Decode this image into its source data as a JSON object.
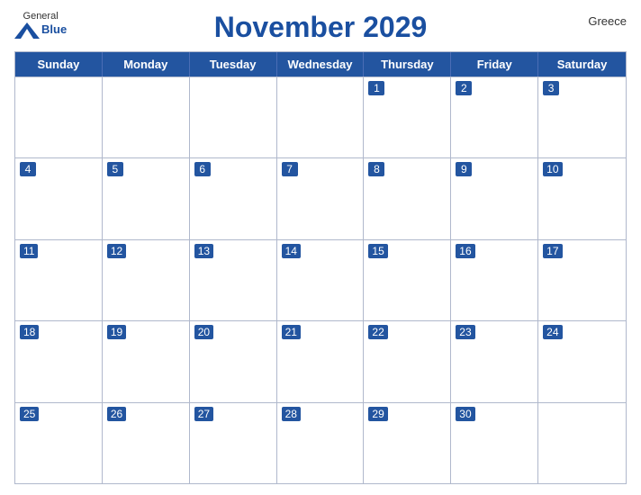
{
  "header": {
    "title": "November 2029",
    "country": "Greece",
    "logo": {
      "general": "General",
      "blue": "Blue"
    }
  },
  "calendar": {
    "day_headers": [
      "Sunday",
      "Monday",
      "Tuesday",
      "Wednesday",
      "Thursday",
      "Friday",
      "Saturday"
    ],
    "weeks": [
      [
        {
          "day": null
        },
        {
          "day": null
        },
        {
          "day": null
        },
        {
          "day": null
        },
        {
          "day": 1
        },
        {
          "day": 2
        },
        {
          "day": 3
        }
      ],
      [
        {
          "day": 4
        },
        {
          "day": 5
        },
        {
          "day": 6
        },
        {
          "day": 7
        },
        {
          "day": 8
        },
        {
          "day": 9
        },
        {
          "day": 10
        }
      ],
      [
        {
          "day": 11
        },
        {
          "day": 12
        },
        {
          "day": 13
        },
        {
          "day": 14
        },
        {
          "day": 15
        },
        {
          "day": 16
        },
        {
          "day": 17
        }
      ],
      [
        {
          "day": 18
        },
        {
          "day": 19
        },
        {
          "day": 20
        },
        {
          "day": 21
        },
        {
          "day": 22
        },
        {
          "day": 23
        },
        {
          "day": 24
        }
      ],
      [
        {
          "day": 25
        },
        {
          "day": 26
        },
        {
          "day": 27
        },
        {
          "day": 28
        },
        {
          "day": 29
        },
        {
          "day": 30
        },
        {
          "day": null
        }
      ]
    ]
  }
}
